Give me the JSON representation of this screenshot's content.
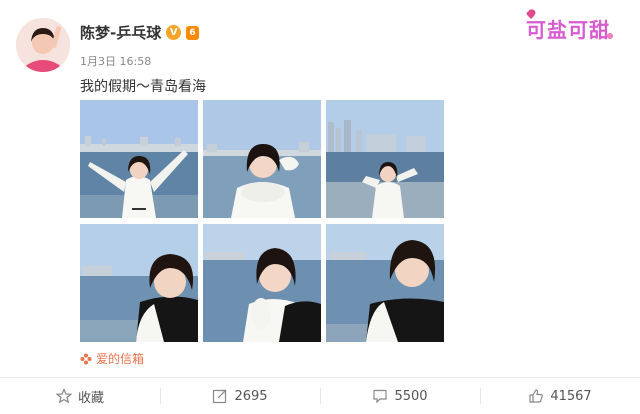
{
  "post": {
    "author": "陈梦-乒乓球",
    "verified_badge": "V",
    "level_badge": "6",
    "time": "1月3日 16:58",
    "text": "我的假期～青岛看海",
    "source_tag": "爱的信箱"
  },
  "watermark": {
    "text": "可盐可甜"
  },
  "photos": [
    {
      "id": 1,
      "scene": "arms-raised"
    },
    {
      "id": 2,
      "scene": "hand-on-head"
    },
    {
      "id": 3,
      "scene": "saluting-distance"
    },
    {
      "id": 4,
      "scene": "closeup-left"
    },
    {
      "id": 5,
      "scene": "closeup-center"
    },
    {
      "id": 6,
      "scene": "closeup-right"
    }
  ],
  "actions": {
    "favorite": {
      "label": "收藏",
      "icon": "star-icon"
    },
    "repost": {
      "count": "2695",
      "icon": "repost-icon"
    },
    "comment": {
      "count": "5500",
      "icon": "comment-icon"
    },
    "like": {
      "count": "41567",
      "icon": "thumbs-up-icon"
    }
  },
  "colors": {
    "brand_orange": "#eb7350",
    "badge_gold": "#f7a428",
    "watermark_pink": "#d85bd0"
  }
}
